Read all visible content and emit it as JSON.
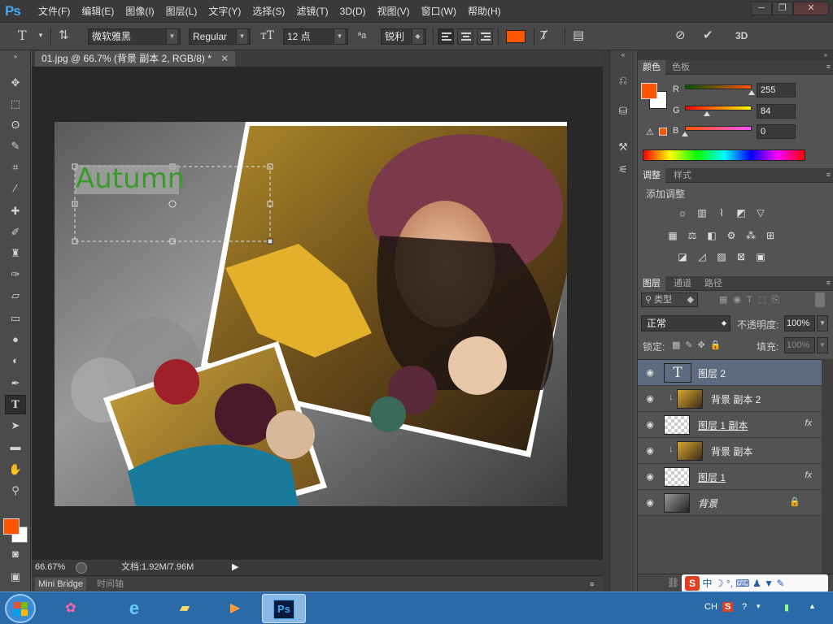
{
  "app": {
    "logo": "Ps"
  },
  "menu": [
    "文件(F)",
    "编辑(E)",
    "图像(I)",
    "图层(L)",
    "文字(Y)",
    "选择(S)",
    "滤镜(T)",
    "3D(D)",
    "视图(V)",
    "窗口(W)",
    "帮助(H)"
  ],
  "window": {
    "minimize": "─",
    "restore": "❐",
    "close": "✕"
  },
  "options": {
    "font_family": "微软雅黑",
    "font_style": "Regular",
    "font_size": "12 点",
    "aa_label": "ªa",
    "aa_mode": "锐利",
    "text_color": "#ff5400",
    "label_3d": "3D"
  },
  "document": {
    "tab_title": "01.jpg @ 66.7% (背景 副本 2, RGB/8) *",
    "text_layer_content": "Autumn",
    "zoom": "66.67%",
    "doc_size": "文档:1.92M/7.96M"
  },
  "bottom_tabs": [
    "Mini Bridge",
    "时间轴"
  ],
  "color_panel": {
    "tabs": [
      "颜色",
      "色板"
    ],
    "r_label": "R",
    "g_label": "G",
    "b_label": "B",
    "r": "255",
    "g": "84",
    "b": "0",
    "r_value": 255,
    "g_value": 84,
    "b_value": 0,
    "swatch_fg": "#ff5400"
  },
  "adjust_panel": {
    "tabs": [
      "调整",
      "样式"
    ],
    "add_label": "添加调整"
  },
  "layers_panel": {
    "tabs": [
      "图层",
      "通道",
      "路径"
    ],
    "filter_label": "类型",
    "blend_mode": "正常",
    "opacity_label": "不透明度:",
    "opacity": "100%",
    "lock_label": "锁定:",
    "fill_label": "填充:",
    "fill": "100%",
    "layers": [
      {
        "name": "图层 2",
        "fx": "",
        "selected": true
      },
      {
        "name": "背景 副本 2",
        "fx": "",
        "selected": false
      },
      {
        "name": "图层 1 副本",
        "fx": "fx",
        "selected": false
      },
      {
        "name": "背景 副本",
        "fx": "",
        "selected": false
      },
      {
        "name": "图层 1",
        "fx": "fx",
        "selected": false
      },
      {
        "name": "背景",
        "fx": "",
        "selected": false
      }
    ]
  },
  "taskbar": {
    "ime_lang": "CH",
    "ime_mode": "中",
    "ps_label": "Ps"
  }
}
